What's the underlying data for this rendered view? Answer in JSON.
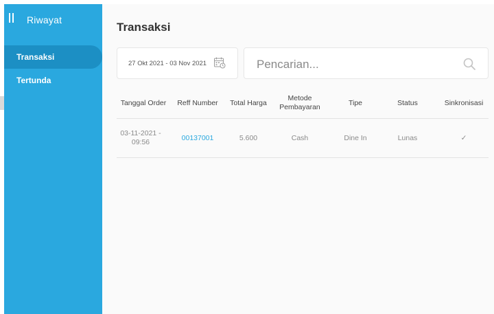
{
  "sidebar": {
    "title": "Riwayat",
    "items": [
      {
        "label": "Transaksi",
        "active": true
      },
      {
        "label": "Tertunda",
        "active": false
      }
    ]
  },
  "page": {
    "title": "Transaksi"
  },
  "filters": {
    "date_range": "27 Okt 2021 - 03 Nov 2021",
    "search_placeholder": "Pencarian...",
    "search_value": ""
  },
  "table": {
    "headers": [
      "Tanggal Order",
      "Reff Number",
      "Total Harga",
      "Metode Pembayaran",
      "Tipe",
      "Status",
      "Sinkronisasi"
    ],
    "rows": [
      {
        "tanggal_order": "03-11-2021 - 09:56",
        "reff_number": "00137001",
        "total_harga": "5.600",
        "metode": "Cash",
        "tipe": "Dine In",
        "status": "Lunas",
        "sinkronisasi": "✓"
      }
    ]
  },
  "colors": {
    "sidebar": "#2aa8df",
    "sidebar_active": "#1c8fc4",
    "link": "#2aa8df"
  },
  "icons": {
    "menu": "menu-icon",
    "calendar": "calendar-icon",
    "search": "search-icon"
  }
}
